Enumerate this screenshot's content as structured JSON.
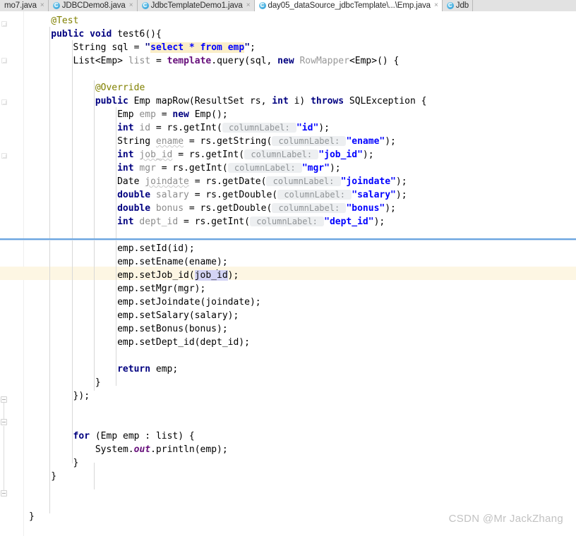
{
  "window": {
    "app": "IntelliJ IDEA Editor",
    "title": "day05_dataSource_jdbcTemplate"
  },
  "tabs": [
    {
      "label": "mo7.java",
      "icon": "java-class-icon",
      "active": false,
      "closable": true,
      "truncated_left": true
    },
    {
      "label": "JDBCDemo8.java",
      "icon": "java-class-icon",
      "active": false,
      "closable": true
    },
    {
      "label": "JdbcTemplateDemo1.java",
      "icon": "java-class-icon",
      "active": false,
      "closable": true
    },
    {
      "label": "day05_dataSource_jdbcTemplate\\...\\Emp.java",
      "icon": "java-class-icon",
      "active": true,
      "closable": true
    },
    {
      "label": "Jdb",
      "icon": "java-class-icon",
      "active": false,
      "closable": false,
      "truncated_right": true
    }
  ],
  "tab_close_glyph": "×",
  "class_icon_letter": "C",
  "editor": {
    "language": "java",
    "selected_text": "job_id",
    "caret_position_in_selection": 4,
    "highlighted_literal": "select * from emp",
    "lines": [
      {
        "n": 1,
        "indent": 4,
        "tokens": [
          {
            "t": "@Test",
            "c": "ann"
          }
        ]
      },
      {
        "n": 2,
        "indent": 4,
        "tokens": [
          {
            "t": "public",
            "c": "kw"
          },
          {
            "t": " ",
            "c": "plain"
          },
          {
            "t": "void",
            "c": "kw"
          },
          {
            "t": " test6(){",
            "c": "plain"
          }
        ]
      },
      {
        "n": 3,
        "indent": 8,
        "tokens": [
          {
            "t": "String sql = ",
            "c": "plain"
          },
          {
            "t": "\"",
            "c": "quo"
          },
          {
            "t": "select * from emp",
            "c": "str hl"
          },
          {
            "t": "\"",
            "c": "quo"
          },
          {
            "t": ";",
            "c": "plain"
          }
        ]
      },
      {
        "n": 4,
        "indent": 8,
        "tokens": [
          {
            "t": "List<Emp> ",
            "c": "plain"
          },
          {
            "t": "list",
            "c": "lvar"
          },
          {
            "t": " = ",
            "c": "plain"
          },
          {
            "t": "template",
            "c": "fld"
          },
          {
            "t": ".query(sql, ",
            "c": "plain"
          },
          {
            "t": "new",
            "c": "kw"
          },
          {
            "t": " ",
            "c": "plain"
          },
          {
            "t": "RowMapper",
            "c": "gry"
          },
          {
            "t": "<Emp>() {",
            "c": "plain"
          }
        ]
      },
      {
        "n": 5,
        "indent": 0,
        "tokens": []
      },
      {
        "n": 6,
        "indent": 12,
        "tokens": [
          {
            "t": "@Override",
            "c": "ann"
          }
        ]
      },
      {
        "n": 7,
        "indent": 12,
        "tokens": [
          {
            "t": "public",
            "c": "kw"
          },
          {
            "t": " Emp mapRow(ResultSet rs, ",
            "c": "plain"
          },
          {
            "t": "int",
            "c": "kw"
          },
          {
            "t": " i) ",
            "c": "plain"
          },
          {
            "t": "throws",
            "c": "kw"
          },
          {
            "t": " SQLException {",
            "c": "plain"
          }
        ]
      },
      {
        "n": 8,
        "indent": 16,
        "tokens": [
          {
            "t": "Emp ",
            "c": "plain"
          },
          {
            "t": "emp",
            "c": "lvar"
          },
          {
            "t": " = ",
            "c": "plain"
          },
          {
            "t": "new",
            "c": "kw"
          },
          {
            "t": " Emp();",
            "c": "plain"
          }
        ]
      },
      {
        "n": 9,
        "indent": 16,
        "tokens": [
          {
            "t": "int",
            "c": "kw"
          },
          {
            "t": " ",
            "c": "plain"
          },
          {
            "t": "id",
            "c": "lvar"
          },
          {
            "t": " = rs.getInt(",
            "c": "plain"
          },
          {
            "t": " columnLabel: ",
            "c": "hint"
          },
          {
            "t": "\"id\"",
            "c": "str"
          },
          {
            "t": ");",
            "c": "plain"
          }
        ]
      },
      {
        "n": 10,
        "indent": 16,
        "tokens": [
          {
            "t": "String ",
            "c": "plain"
          },
          {
            "t": "ename",
            "c": "lvar squig"
          },
          {
            "t": " = rs.getString(",
            "c": "plain"
          },
          {
            "t": " columnLabel: ",
            "c": "hint"
          },
          {
            "t": "\"ename\"",
            "c": "str"
          },
          {
            "t": ");",
            "c": "plain"
          }
        ]
      },
      {
        "n": 11,
        "indent": 16,
        "tokens": [
          {
            "t": "int",
            "c": "kw"
          },
          {
            "t": " ",
            "c": "plain"
          },
          {
            "t": "job_id",
            "c": "lvar squig"
          },
          {
            "t": " = rs.getInt(",
            "c": "plain"
          },
          {
            "t": " columnLabel: ",
            "c": "hint"
          },
          {
            "t": "\"job_id\"",
            "c": "str"
          },
          {
            "t": ");",
            "c": "plain"
          }
        ]
      },
      {
        "n": 12,
        "indent": 16,
        "tokens": [
          {
            "t": "int",
            "c": "kw"
          },
          {
            "t": " ",
            "c": "plain"
          },
          {
            "t": "mgr",
            "c": "lvar"
          },
          {
            "t": " = rs.getInt(",
            "c": "plain"
          },
          {
            "t": " columnLabel: ",
            "c": "hint"
          },
          {
            "t": "\"mgr\"",
            "c": "str"
          },
          {
            "t": ");",
            "c": "plain"
          }
        ]
      },
      {
        "n": 13,
        "indent": 16,
        "tokens": [
          {
            "t": "Date ",
            "c": "plain"
          },
          {
            "t": "joindate",
            "c": "lvar squig"
          },
          {
            "t": " = rs.getDate(",
            "c": "plain"
          },
          {
            "t": " columnLabel: ",
            "c": "hint"
          },
          {
            "t": "\"joindate\"",
            "c": "str"
          },
          {
            "t": ");",
            "c": "plain"
          }
        ]
      },
      {
        "n": 14,
        "indent": 16,
        "tokens": [
          {
            "t": "double",
            "c": "kw"
          },
          {
            "t": " ",
            "c": "plain"
          },
          {
            "t": "salary",
            "c": "lvar"
          },
          {
            "t": " = rs.getDouble(",
            "c": "plain"
          },
          {
            "t": " columnLabel: ",
            "c": "hint"
          },
          {
            "t": "\"salary\"",
            "c": "str"
          },
          {
            "t": ");",
            "c": "plain"
          }
        ]
      },
      {
        "n": 15,
        "indent": 16,
        "tokens": [
          {
            "t": "double",
            "c": "kw"
          },
          {
            "t": " ",
            "c": "plain"
          },
          {
            "t": "bonus",
            "c": "lvar"
          },
          {
            "t": " = rs.getDouble(",
            "c": "plain"
          },
          {
            "t": " columnLabel: ",
            "c": "hint"
          },
          {
            "t": "\"bonus\"",
            "c": "str"
          },
          {
            "t": ");",
            "c": "plain"
          }
        ]
      },
      {
        "n": 16,
        "indent": 16,
        "tokens": [
          {
            "t": "int",
            "c": "kw"
          },
          {
            "t": " ",
            "c": "plain"
          },
          {
            "t": "dept_id",
            "c": "lvar"
          },
          {
            "t": " = rs.getInt(",
            "c": "plain"
          },
          {
            "t": " columnLabel: ",
            "c": "hint"
          },
          {
            "t": "\"dept_id\"",
            "c": "str"
          },
          {
            "t": ");",
            "c": "plain"
          }
        ]
      },
      {
        "n": 17,
        "indent": 0,
        "tokens": []
      },
      {
        "n": 18,
        "indent": 16,
        "tokens": [
          {
            "t": "emp.setId(id);",
            "c": "plain"
          }
        ]
      },
      {
        "n": 19,
        "indent": 16,
        "tokens": [
          {
            "t": "emp.setEname(ename);",
            "c": "plain"
          }
        ]
      },
      {
        "n": 20,
        "indent": 16,
        "current": true,
        "tokens": [
          {
            "t": "emp.setJob_id(",
            "c": "plain"
          },
          {
            "t": "job_",
            "c": "sel"
          },
          {
            "t": "CARET",
            "c": "caret"
          },
          {
            "t": "id",
            "c": "sel"
          },
          {
            "t": ");",
            "c": "plain"
          }
        ]
      },
      {
        "n": 21,
        "indent": 16,
        "tokens": [
          {
            "t": "emp.setMgr(mgr);",
            "c": "plain"
          }
        ]
      },
      {
        "n": 22,
        "indent": 16,
        "tokens": [
          {
            "t": "emp.setJoindate(joindate);",
            "c": "plain"
          }
        ]
      },
      {
        "n": 23,
        "indent": 16,
        "tokens": [
          {
            "t": "emp.setSalary(salary);",
            "c": "plain"
          }
        ]
      },
      {
        "n": 24,
        "indent": 16,
        "tokens": [
          {
            "t": "emp.setBonus(bonus);",
            "c": "plain"
          }
        ]
      },
      {
        "n": 25,
        "indent": 16,
        "tokens": [
          {
            "t": "emp.setDept_id(dept_id);",
            "c": "plain"
          }
        ]
      },
      {
        "n": 26,
        "indent": 0,
        "tokens": []
      },
      {
        "n": 27,
        "indent": 16,
        "tokens": [
          {
            "t": "return",
            "c": "kw"
          },
          {
            "t": " emp;",
            "c": "plain"
          }
        ]
      },
      {
        "n": 28,
        "indent": 12,
        "tokens": [
          {
            "t": "}",
            "c": "plain"
          }
        ]
      },
      {
        "n": 29,
        "indent": 8,
        "tokens": [
          {
            "t": "});",
            "c": "plain"
          }
        ]
      },
      {
        "n": 30,
        "indent": 0,
        "tokens": []
      },
      {
        "n": 31,
        "indent": 0,
        "tokens": []
      },
      {
        "n": 32,
        "indent": 8,
        "tokens": [
          {
            "t": "for",
            "c": "kw"
          },
          {
            "t": " (Emp emp : list) {",
            "c": "plain"
          }
        ]
      },
      {
        "n": 33,
        "indent": 12,
        "tokens": [
          {
            "t": "System.",
            "c": "plain"
          },
          {
            "t": "out",
            "c": "sfld"
          },
          {
            "t": ".println(emp);",
            "c": "plain"
          }
        ]
      },
      {
        "n": 34,
        "indent": 8,
        "tokens": [
          {
            "t": "}",
            "c": "plain"
          }
        ]
      },
      {
        "n": 35,
        "indent": 4,
        "tokens": [
          {
            "t": "}",
            "c": "plain"
          }
        ]
      },
      {
        "n": 36,
        "indent": 0,
        "tokens": []
      },
      {
        "n": 37,
        "indent": 0,
        "tokens": []
      },
      {
        "n": 38,
        "indent": 0,
        "tokens": [
          {
            "t": "}",
            "c": "plain"
          }
        ]
      }
    ]
  },
  "colors": {
    "keyword": "#000080",
    "string": "#0000ff",
    "annotation": "#808000",
    "local_variable": "#8c8c8c",
    "field": "#660e7a",
    "hint_background": "#edeff1",
    "literal_highlight": "#faeec8",
    "current_line": "#fdf6e3",
    "selection": "#d4d4f5",
    "separator": "#6aa5e0",
    "tabbar_background": "#e2e2e2",
    "editor_background": "#ffffff",
    "watermark": "#c2c2c2"
  },
  "watermark": {
    "text": "CSDN @Mr JackZhang"
  }
}
